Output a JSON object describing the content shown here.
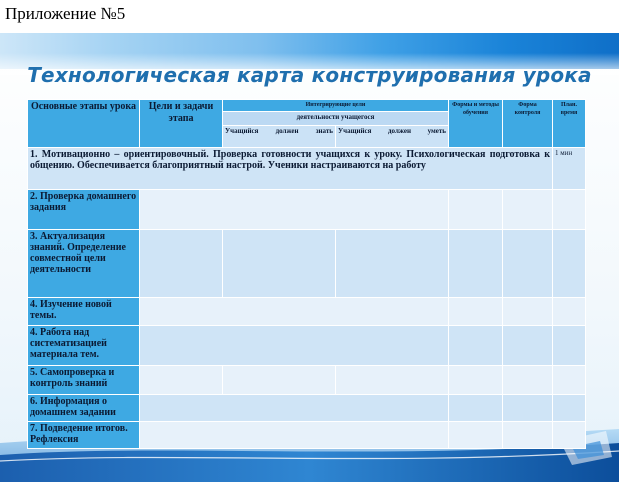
{
  "caption": "Приложение №5",
  "title": "Технологическая карта конструирования урока",
  "header": {
    "stages": "Основные этапы урока",
    "goals": "Цели и задачи этапа",
    "integrating_goals": "Интегрирующие цели",
    "student_activity": "деятельности учащегося",
    "must_know": "Учащийся должен знать",
    "must_be_able": "Учащийся должен уметь",
    "forms": "Формы и методы обучения",
    "control": "Форма контроля",
    "time": "План. время"
  },
  "rows": [
    {
      "label": "1. Мотивационно – ориентировочный. Проверка готовности учащихся к уроку. Психологическая подготовка к общению. Обеспечивается благоприятный настрой. Ученики настраиваются на работу",
      "time": "1 мин"
    },
    {
      "label": "2. Проверка домашнего задания"
    },
    {
      "label": "3. Актуализация знаний. Определение совместной цели деятельности"
    },
    {
      "label": "4. Изучение новой темы."
    },
    {
      "label": "4. Работа над систематизацией материала тем."
    },
    {
      "label": "5. Самопроверка и контроль знаний"
    },
    {
      "label": "6. Информация о домашнем задании"
    },
    {
      "label": "7. Подведение итогов. Рефлексия"
    }
  ]
}
